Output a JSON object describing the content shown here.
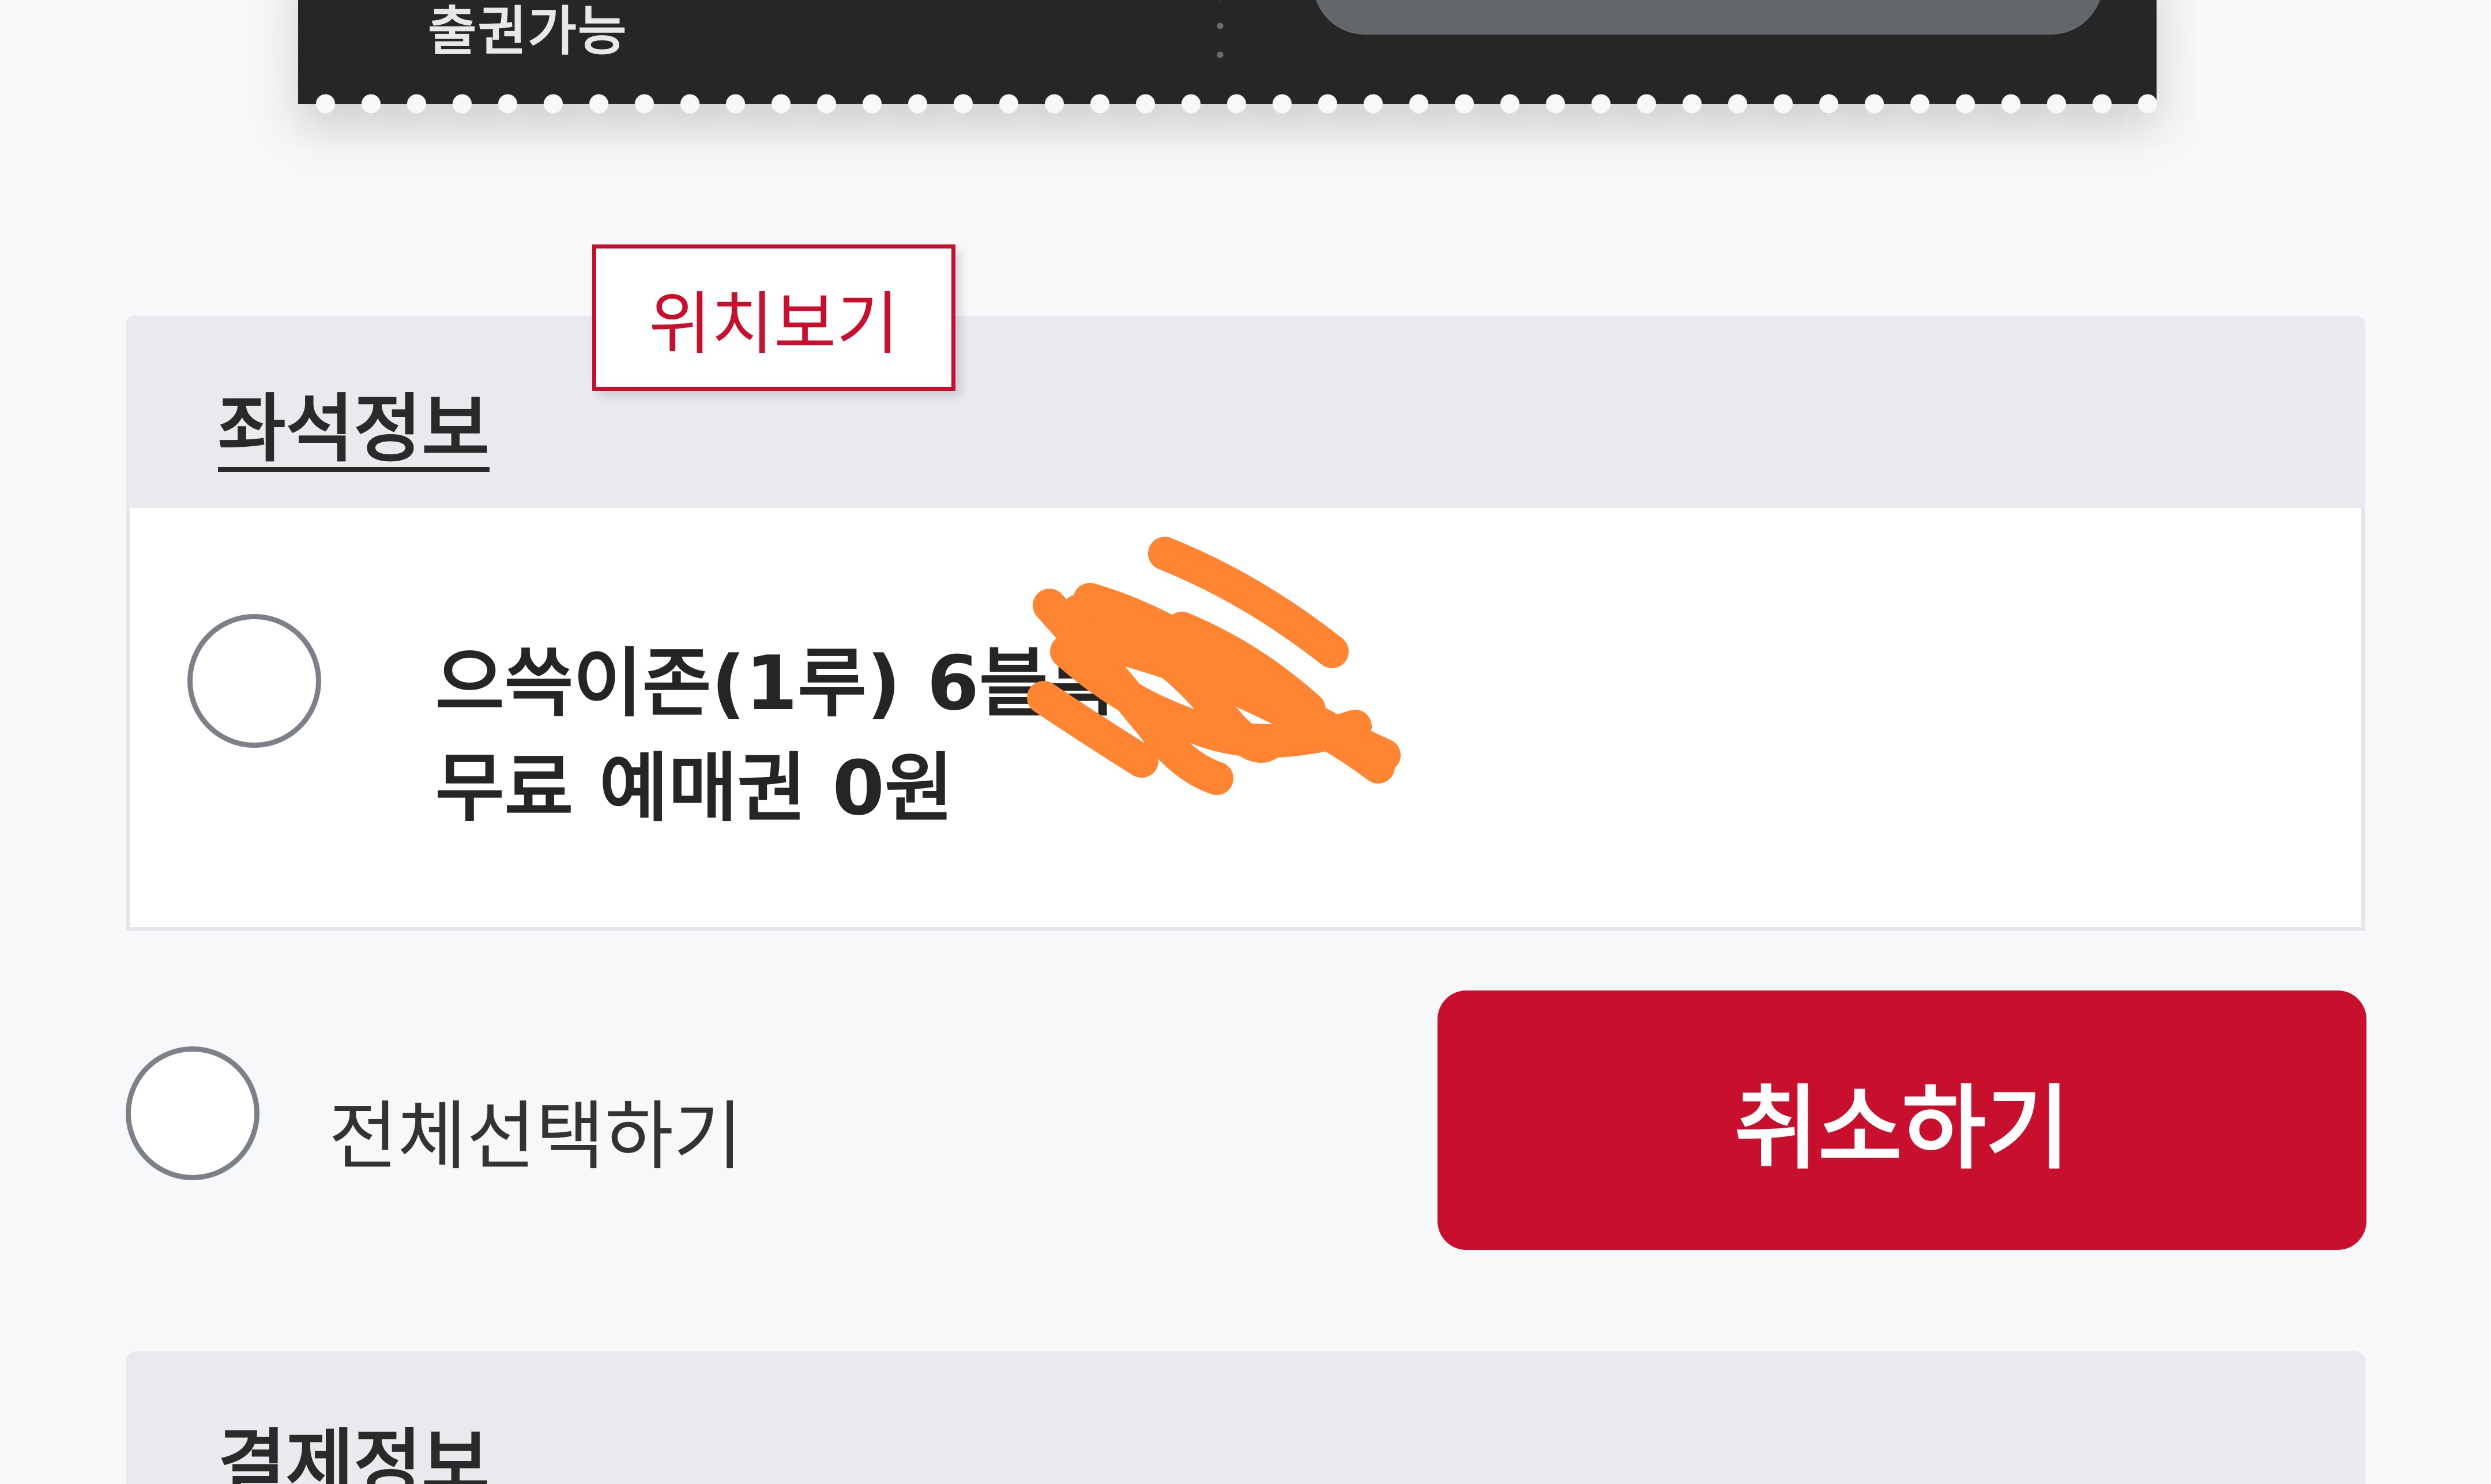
{
  "ticket": {
    "status_text": "출권가능"
  },
  "seat_info": {
    "title": "좌석정보",
    "location_button": "위치보기",
    "seat_line1": "으쓱이존(1루) 6블록",
    "seat_line2": "무료 예매권 0원"
  },
  "actions": {
    "select_all_label": "전체선택하기",
    "cancel_label": "취소하기"
  },
  "payment_info": {
    "title": "결제정보"
  },
  "colors": {
    "accent": "#c8102e",
    "scribble": "#ff8533",
    "ticket_bg": "#262626"
  }
}
